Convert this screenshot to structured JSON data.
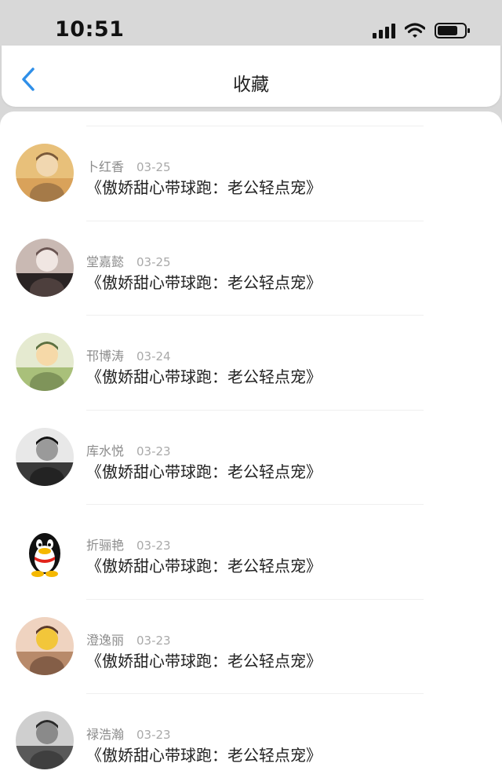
{
  "status_bar": {
    "time": "10:51"
  },
  "header": {
    "title": "收藏"
  },
  "favorites": [
    {
      "name": "卜红香",
      "date": "03-25",
      "title": "《傲娇甜心带球跑：老公轻点宠》",
      "avatar_color": "#d8a860"
    },
    {
      "name": "堂嘉懿",
      "date": "03-25",
      "title": "《傲娇甜心带球跑：老公轻点宠》",
      "avatar_color": "#5a4a48"
    },
    {
      "name": "邗博涛",
      "date": "03-24",
      "title": "《傲娇甜心带球跑：老公轻点宠》",
      "avatar_color": "#b9c98a"
    },
    {
      "name": "库水悦",
      "date": "03-23",
      "title": "《傲娇甜心带球跑：老公轻点宠》",
      "avatar_color": "#6b6b6b"
    },
    {
      "name": "折骊艳",
      "date": "03-23",
      "title": "《傲娇甜心带球跑：老公轻点宠》",
      "avatar_color": "#ffffff"
    },
    {
      "name": "澄逸丽",
      "date": "03-23",
      "title": "《傲娇甜心带球跑：老公轻点宠》",
      "avatar_color": "#c79a7a"
    },
    {
      "name": "禄浩瀚",
      "date": "03-23",
      "title": "《傲娇甜心带球跑：老公轻点宠》",
      "avatar_color": "#7a7a7a"
    }
  ],
  "colors": {
    "accent": "#2f8fe8",
    "status_bar_bg": "#d8d8d8"
  },
  "icons": {
    "back": "chevron-left-icon",
    "signal": "signal-icon",
    "wifi": "wifi-icon",
    "battery": "battery-icon"
  }
}
